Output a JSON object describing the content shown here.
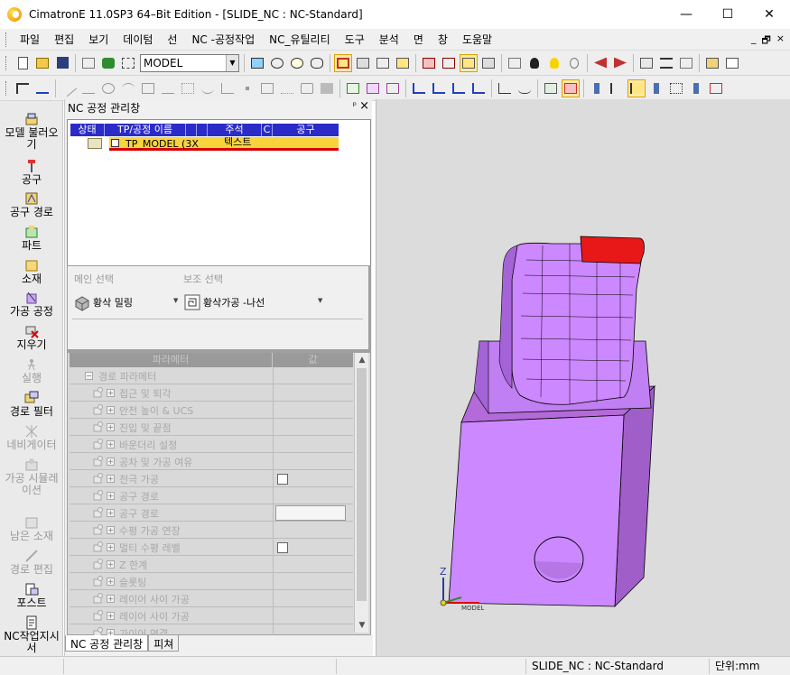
{
  "window": {
    "title": "CimatronE 11.0SP3 64–Bit Edition - [SLIDE_NC : NC-Standard]",
    "minimize": "—",
    "maximize": "☐",
    "close": "✕"
  },
  "menu": {
    "items": [
      "파일",
      "편집",
      "보기",
      "데이텀",
      "선",
      "NC -공정작업",
      "NC_유틸리티",
      "도구",
      "분석",
      "면",
      "창",
      "도움말"
    ],
    "mdi": [
      "_",
      "🗗",
      "×"
    ]
  },
  "toolbar": {
    "model_combo": "MODEL",
    "combo_arrow": "▼"
  },
  "leftbar": {
    "items": [
      {
        "label": "모델 불러오\n기",
        "enabled": true,
        "icon": "load-model-icon"
      },
      {
        "label": "공구",
        "enabled": true,
        "icon": "tool-icon"
      },
      {
        "label": "공구 경로",
        "enabled": true,
        "icon": "toolpath-icon"
      },
      {
        "label": "파트",
        "enabled": true,
        "icon": "part-icon"
      },
      {
        "label": "소재",
        "enabled": true,
        "icon": "stock-icon"
      },
      {
        "label": "가공 공정",
        "enabled": true,
        "icon": "procedure-icon"
      },
      {
        "label": "지우기",
        "enabled": true,
        "icon": "delete-icon"
      },
      {
        "label": "실행",
        "enabled": false,
        "icon": "run-icon"
      },
      {
        "label": "경로 필터",
        "enabled": true,
        "icon": "path-filter-icon"
      },
      {
        "label": "네비게이터",
        "enabled": false,
        "icon": "navigator-icon"
      },
      {
        "label": "가공 시뮬레\n이션",
        "enabled": false,
        "icon": "simulation-icon"
      },
      {
        "label": "남은 소재",
        "enabled": false,
        "icon": "remaining-stock-icon"
      },
      {
        "label": "경로 편집",
        "enabled": false,
        "icon": "path-edit-icon"
      },
      {
        "label": "포스트",
        "enabled": true,
        "icon": "post-icon"
      },
      {
        "label": "NC작업지시\n서",
        "enabled": true,
        "icon": "nc-doc-icon"
      }
    ]
  },
  "nc_panel": {
    "title": "NC 공정 관리창",
    "pin": "ᵖ",
    "close": "×",
    "tree_columns": [
      "상태",
      "TP/공정 이름",
      "",
      "",
      "주석",
      "C",
      "공구"
    ],
    "tree_row": {
      "name": "TP_MODEL (3X",
      "note": "텍스트"
    },
    "main_select_label": "메인 선택",
    "sub_select_label": "보조 선택",
    "main_select_value": "황삭 밀링",
    "sub_select_value": "황삭가공 -나선",
    "param_header": {
      "param": "파라메터",
      "value": "값"
    },
    "params": [
      {
        "label": "경로 파라메터",
        "level": 0,
        "control": ""
      },
      {
        "label": "접근 및 퇴각",
        "level": 1,
        "control": ""
      },
      {
        "label": "안전 높이 & UCS",
        "level": 1,
        "control": ""
      },
      {
        "label": "진입 및 끝점",
        "level": 1,
        "control": ""
      },
      {
        "label": "바운더리 설정",
        "level": 1,
        "control": ""
      },
      {
        "label": "공차 및 가공 여유",
        "level": 1,
        "control": ""
      },
      {
        "label": "전극 가공",
        "level": 1,
        "control": "checkbox"
      },
      {
        "label": "공구 경로",
        "level": 1,
        "control": ""
      },
      {
        "label": "공구 경로",
        "level": 1,
        "control": "field"
      },
      {
        "label": "수평 가공 연장",
        "level": 1,
        "control": ""
      },
      {
        "label": "멀티 수평 레벨",
        "level": 1,
        "control": "checkbox"
      },
      {
        "label": "Z 한계",
        "level": 1,
        "control": ""
      },
      {
        "label": "슬롯팅",
        "level": 1,
        "control": ""
      },
      {
        "label": "레이어 사이 가공",
        "level": 1,
        "control": ""
      },
      {
        "label": "레이어 사이 가공",
        "level": 1,
        "control": ""
      },
      {
        "label": "가이어 연결",
        "level": 1,
        "control": ""
      }
    ],
    "tabs": [
      "NC 공정 관리창",
      "피쳐"
    ]
  },
  "viewport": {
    "model_color": "#cc88ff",
    "highlight_color": "#e81818",
    "axis_z": "Z",
    "axis_label": "MODEL"
  },
  "status": {
    "doc": "SLIDE_NC : NC-Standard",
    "unit": "단위:mm"
  }
}
